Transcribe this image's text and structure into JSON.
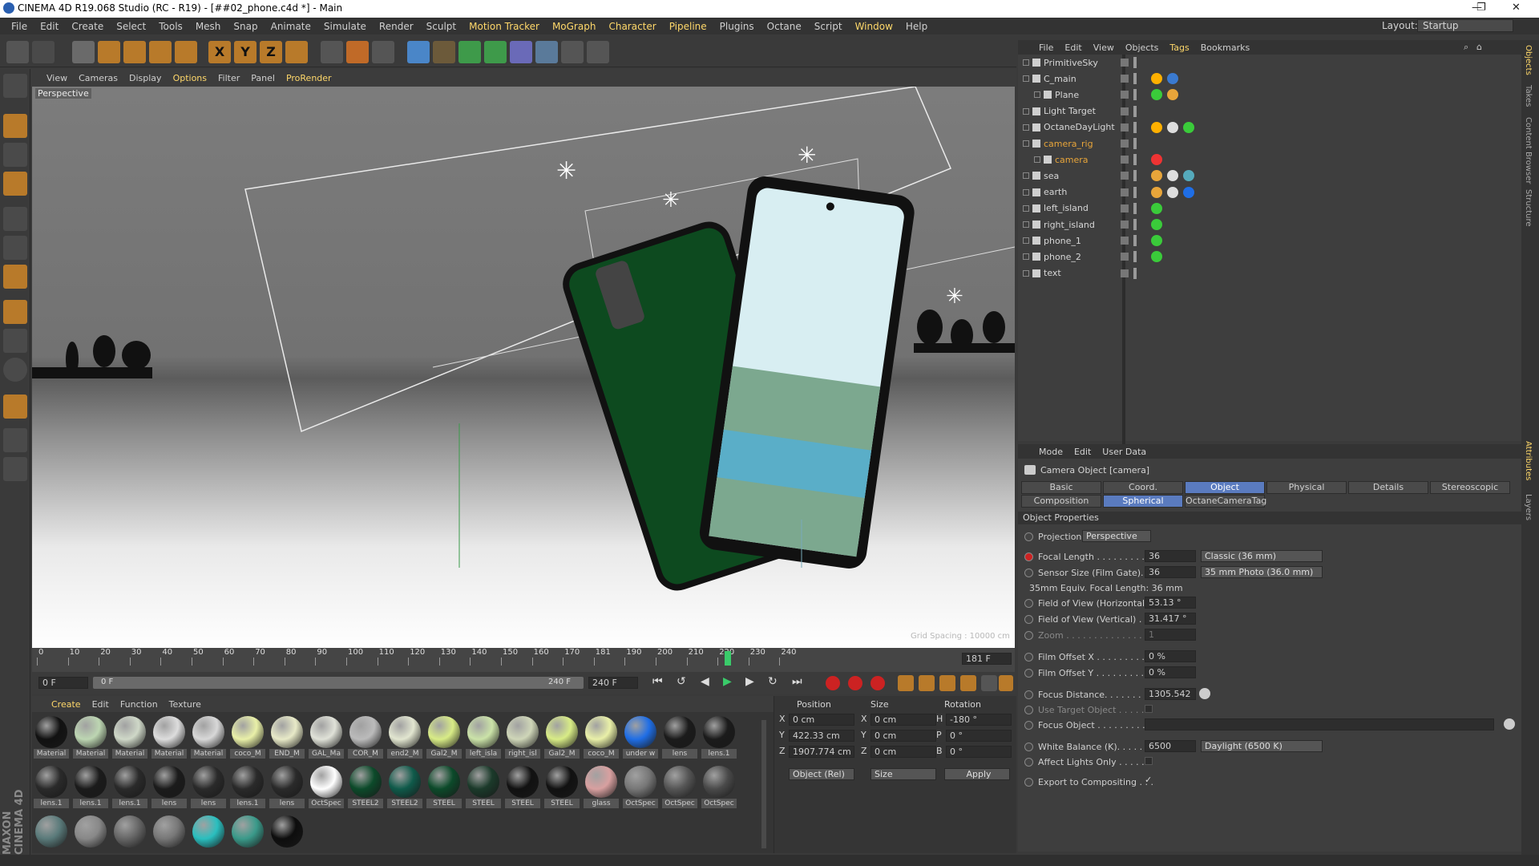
{
  "window": {
    "title": "CINEMA 4D R19.068 Studio (RC - R19) - [##02_phone.c4d *] - Main",
    "controls": [
      "—",
      "❐",
      "✕"
    ]
  },
  "menu": [
    "File",
    "Edit",
    "Create",
    "Select",
    "Tools",
    "Mesh",
    "Snap",
    "Animate",
    "Simulate",
    "Render",
    "Sculpt",
    "Motion Tracker",
    "MoGraph",
    "Character",
    "Pipeline",
    "Plugins",
    "Octane",
    "Script",
    "Window",
    "Help"
  ],
  "layout": {
    "label": "Layout:",
    "value": "Startup"
  },
  "viewport": {
    "menu": [
      "View",
      "Cameras",
      "Display",
      "Options",
      "Filter",
      "Panel",
      "ProRender"
    ],
    "label": "Perspective",
    "grid_spacing": "Grid Spacing : 10000 cm"
  },
  "timeline": {
    "ticks": [
      "0",
      "10",
      "20",
      "30",
      "40",
      "50",
      "60",
      "70",
      "80",
      "90",
      "100",
      "110",
      "120",
      "130",
      "140",
      "150",
      "160",
      "170",
      "181",
      "190",
      "200",
      "210",
      "220",
      "230",
      "240"
    ],
    "current": "181 F"
  },
  "transport": {
    "start": "0 F",
    "range_start": "0 F",
    "range_end": "240 F",
    "end": "240 F"
  },
  "materials": {
    "menu": [
      "Create",
      "Edit",
      "Function",
      "Texture"
    ],
    "row1": [
      "Material",
      "Material",
      "Material",
      "Material",
      "Material",
      "coco_M",
      "END_M",
      "GAL_Ma",
      "COR_M",
      "end2_M",
      "Gal2_M",
      "left_isla",
      "right_isl",
      "Gal2_M",
      "coco_M",
      "under w",
      "lens",
      "lens.1"
    ],
    "row2": [
      "lens.1",
      "lens.1",
      "lens.1",
      "lens",
      "lens",
      "lens.1",
      "lens",
      "OctSpec",
      "STEEL2",
      "STEEL2",
      "STEEL",
      "STEEL",
      "STEEL",
      "STEEL",
      "glass",
      "OctSpec",
      "OctSpec",
      "OctSpec"
    ],
    "row3": [
      "",
      "",
      "",
      "",
      "",
      "",
      ""
    ]
  },
  "coords": {
    "headers": [
      "Position",
      "Size",
      "Rotation"
    ],
    "rows": [
      {
        "axis": "X",
        "pos": "0 cm",
        "saxis": "X",
        "size": "0 cm",
        "raxis": "H",
        "rot": "-180 °"
      },
      {
        "axis": "Y",
        "pos": "422.33 cm",
        "saxis": "Y",
        "size": "0 cm",
        "raxis": "P",
        "rot": "0 °"
      },
      {
        "axis": "Z",
        "pos": "1907.774 cm",
        "saxis": "Z",
        "size": "0 cm",
        "raxis": "B",
        "rot": "0 °"
      }
    ],
    "mode": "Object (Rel)",
    "size_mode": "Size",
    "apply": "Apply"
  },
  "objects": {
    "menu": [
      "File",
      "Edit",
      "View",
      "Objects",
      "Tags",
      "Bookmarks"
    ],
    "items": [
      {
        "name": "PrimitiveSky"
      },
      {
        "name": "C_main"
      },
      {
        "name": "Plane"
      },
      {
        "name": "Light Target"
      },
      {
        "name": "OctaneDayLight"
      },
      {
        "name": "camera_rig"
      },
      {
        "name": "camera"
      },
      {
        "name": "sea"
      },
      {
        "name": "earth"
      },
      {
        "name": "left_island"
      },
      {
        "name": "right_island"
      },
      {
        "name": "phone_1"
      },
      {
        "name": "phone_2"
      },
      {
        "name": "text"
      }
    ]
  },
  "attributes": {
    "menu": [
      "Mode",
      "Edit",
      "User Data"
    ],
    "title": "Camera Object [camera]",
    "tabs1": [
      "Basic",
      "Coord.",
      "Object",
      "Physical",
      "Details",
      "Stereoscopic"
    ],
    "tabs2": [
      "Composition",
      "Spherical",
      "OctaneCameraTag"
    ],
    "section": "Object Properties",
    "projection": {
      "label": "Projection",
      "value": "Perspective"
    },
    "focal": {
      "label": "Focal Length . . . . . . . . . .",
      "value": "36",
      "preset": "Classic (36 mm)"
    },
    "sensor": {
      "label": "Sensor Size (Film Gate).",
      "value": "36",
      "preset": "35 mm Photo (36.0 mm)"
    },
    "equiv": "35mm Equiv. Focal Length:  36 mm",
    "fovh": {
      "label": "Field of View (Horizontal)",
      "value": "53.13 °"
    },
    "fovv": {
      "label": "Field of View (Vertical) . .",
      "value": "31.417 °"
    },
    "zoom": {
      "label": "Zoom . . . . . . . . . . . . . .",
      "value": "1"
    },
    "offx": {
      "label": "Film Offset X . . . . . . . . .",
      "value": "0 %"
    },
    "offy": {
      "label": "Film Offset Y . . . . . . . . .",
      "value": "0 %"
    },
    "focus": {
      "label": "Focus Distance. . . . . . . . .",
      "value": "1305.542"
    },
    "target": {
      "label": "Use Target Object . . . . ."
    },
    "fobj": {
      "label": "Focus Object . . . . . . . . . ."
    },
    "wb": {
      "label": "White Balance (K). . . . . .",
      "value": "6500",
      "preset": "Daylight (6500 K)"
    },
    "lights": {
      "label": "Affect Lights Only . . . . . ."
    },
    "export": {
      "label": "Export to Compositing . . .",
      "check": "✓"
    }
  },
  "rightstrip": [
    "Objects",
    "Takes",
    "Content Browser",
    "Structure",
    "Attributes",
    "Layers"
  ],
  "brand": "MAXON CINEMA 4D"
}
